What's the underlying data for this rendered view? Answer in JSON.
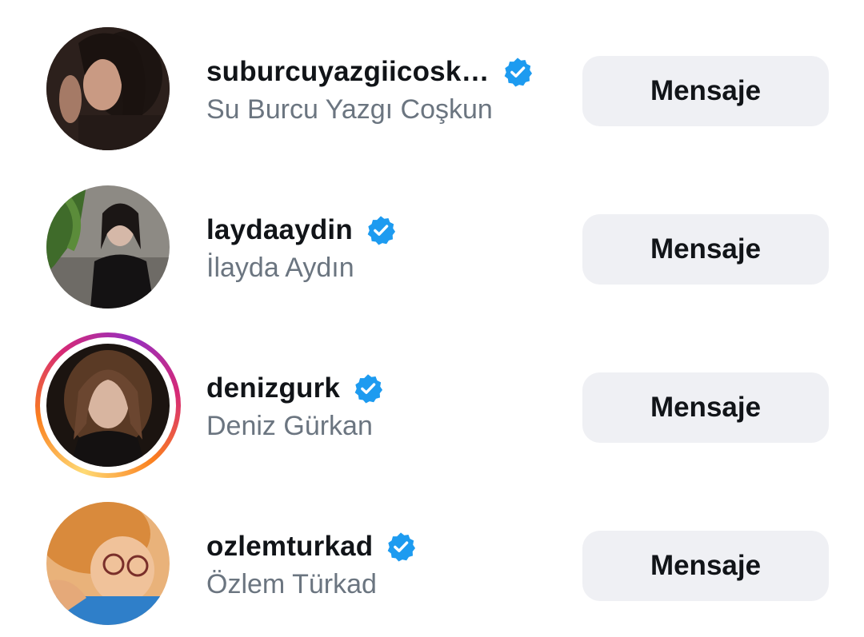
{
  "accounts": [
    {
      "username": "suburcuyazgiicosk…",
      "full_name": "Su Burcu Yazgı Coşkun",
      "verified": true,
      "has_story": false,
      "button_label": "Mensaje"
    },
    {
      "username": "laydaaydin",
      "full_name": "İlayda Aydın",
      "verified": true,
      "has_story": false,
      "button_label": "Mensaje"
    },
    {
      "username": "denizgurk",
      "full_name": "Deniz Gürkan",
      "verified": true,
      "has_story": true,
      "button_label": "Mensaje"
    },
    {
      "username": "ozlemturkad",
      "full_name": "Özlem Türkad",
      "verified": true,
      "has_story": false,
      "button_label": "Mensaje"
    }
  ],
  "colors": {
    "verified_badge": "#1d9bf0",
    "button_bg": "#eff0f4",
    "username_text": "#111418",
    "fullname_text": "#6b7580"
  },
  "icons": {
    "verified": "verified-badge-icon"
  }
}
